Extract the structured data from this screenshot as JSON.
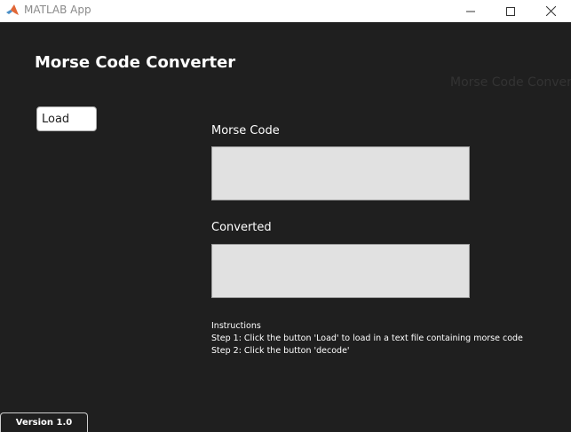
{
  "window": {
    "title": "MATLAB App",
    "icon": "matlab-logo-icon",
    "controls": [
      "minimize-icon",
      "maximize-icon",
      "close-icon"
    ]
  },
  "app": {
    "title": "Morse Code Converter",
    "ghost_title": "Morse Code Converter",
    "load_label": "Load",
    "morse_label": "Morse Code",
    "morse_value": "",
    "converted_label": "Converted",
    "converted_value": "",
    "instructions": {
      "heading": "Instructions",
      "step1": "Step 1: Click the button 'Load' to load in a text file containing morse code",
      "step2": "Step 2: Click the button 'decode'"
    },
    "version": "Version 1.0"
  },
  "colors": {
    "background": "#1f1f1f",
    "titlebar": "#ffffff",
    "field": "#e1e1e1",
    "text": "#ffffff"
  }
}
